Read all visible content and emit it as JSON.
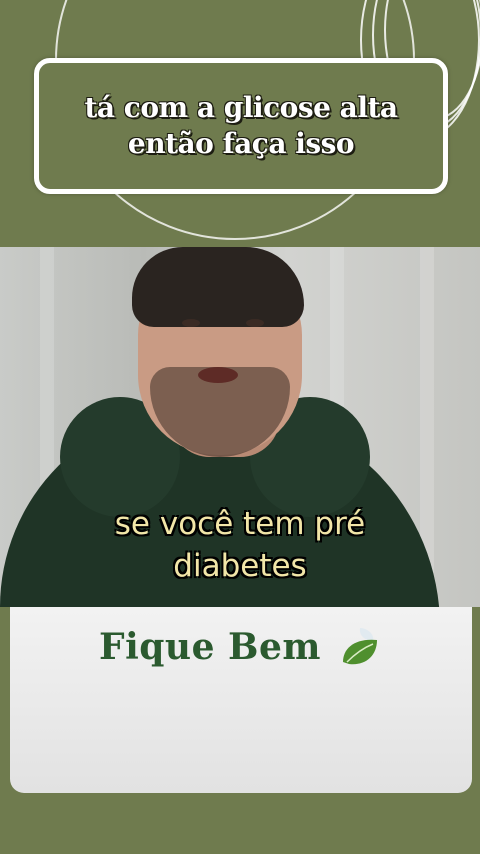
{
  "headline": {
    "line1": "tá com a glicose alta",
    "line2": "então faça isso"
  },
  "video": {
    "caption_line1": "se você tem pré",
    "caption_line2": "diabetes"
  },
  "brand": {
    "name": "Fique Bem",
    "icon": "leaf-icon"
  },
  "colors": {
    "background": "#6f7b4e",
    "brand_green": "#2b5a2f",
    "caption_yellow": "#f2e6a8"
  }
}
